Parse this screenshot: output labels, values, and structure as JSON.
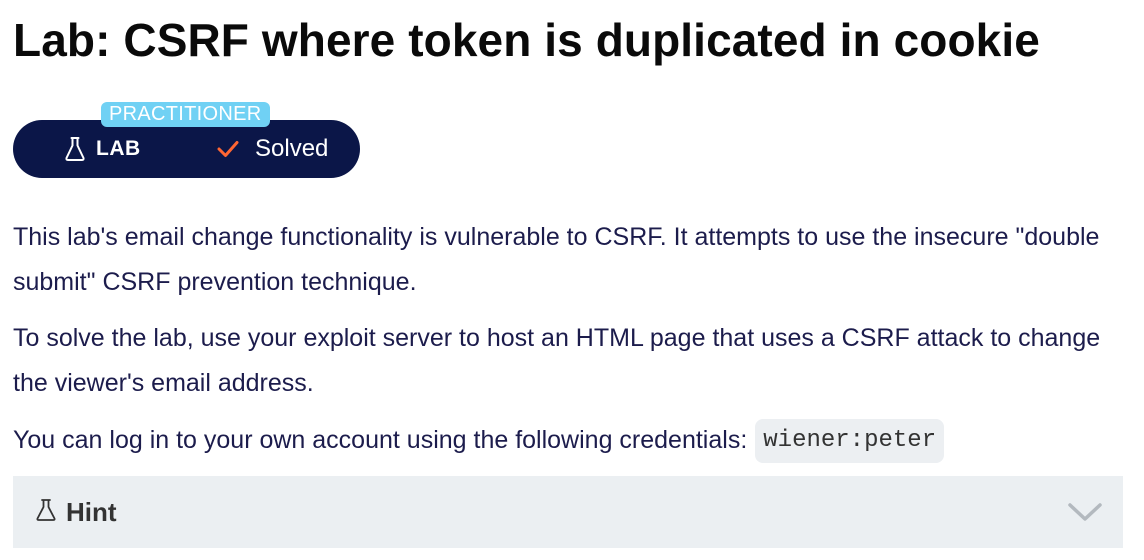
{
  "lab": {
    "title": "Lab: CSRF where token is duplicated in cookie",
    "level": "PRACTITIONER",
    "type_label": "LAB",
    "status_label": "Solved"
  },
  "description": {
    "paragraph_1": "This lab's email change functionality is vulnerable to CSRF. It attempts to use the insecure \"double submit\" CSRF prevention technique.",
    "paragraph_2": "To solve the lab, use your exploit server to host an HTML page that uses a CSRF attack to change the viewer's email address.",
    "paragraph_3": "You can log in to your own account using the following credentials:",
    "credentials": "wiener:peter"
  },
  "hint": {
    "label": "Hint",
    "expanded": false
  },
  "icons": {
    "lab": "flask-icon",
    "solved": "check-icon",
    "hint": "flask-icon",
    "toggle": "chevron-down-icon"
  },
  "colors": {
    "pill_background": "#0b1648",
    "level_badge": "#70d1f4",
    "solved_check": "#ff6633",
    "text": "#1c1c4c",
    "hint_background": "#ebeff2"
  }
}
